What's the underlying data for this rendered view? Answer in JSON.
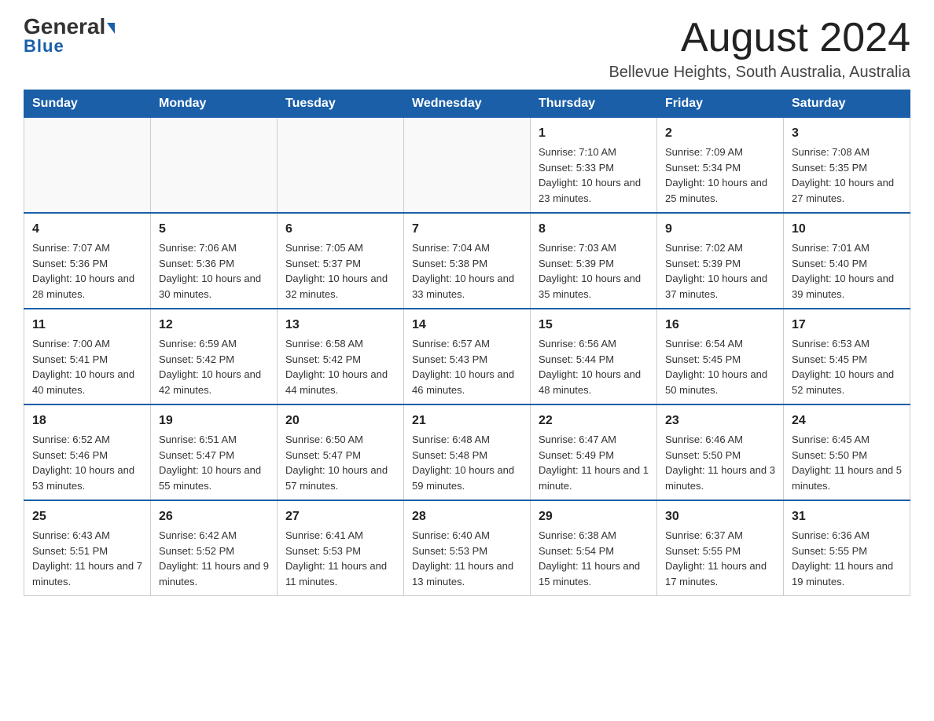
{
  "header": {
    "logo_general": "General",
    "logo_blue": "Blue",
    "month_title": "August 2024",
    "location": "Bellevue Heights, South Australia, Australia"
  },
  "calendar": {
    "days_of_week": [
      "Sunday",
      "Monday",
      "Tuesday",
      "Wednesday",
      "Thursday",
      "Friday",
      "Saturday"
    ],
    "weeks": [
      [
        {
          "day": "",
          "info": ""
        },
        {
          "day": "",
          "info": ""
        },
        {
          "day": "",
          "info": ""
        },
        {
          "day": "",
          "info": ""
        },
        {
          "day": "1",
          "info": "Sunrise: 7:10 AM\nSunset: 5:33 PM\nDaylight: 10 hours and 23 minutes."
        },
        {
          "day": "2",
          "info": "Sunrise: 7:09 AM\nSunset: 5:34 PM\nDaylight: 10 hours and 25 minutes."
        },
        {
          "day": "3",
          "info": "Sunrise: 7:08 AM\nSunset: 5:35 PM\nDaylight: 10 hours and 27 minutes."
        }
      ],
      [
        {
          "day": "4",
          "info": "Sunrise: 7:07 AM\nSunset: 5:36 PM\nDaylight: 10 hours and 28 minutes."
        },
        {
          "day": "5",
          "info": "Sunrise: 7:06 AM\nSunset: 5:36 PM\nDaylight: 10 hours and 30 minutes."
        },
        {
          "day": "6",
          "info": "Sunrise: 7:05 AM\nSunset: 5:37 PM\nDaylight: 10 hours and 32 minutes."
        },
        {
          "day": "7",
          "info": "Sunrise: 7:04 AM\nSunset: 5:38 PM\nDaylight: 10 hours and 33 minutes."
        },
        {
          "day": "8",
          "info": "Sunrise: 7:03 AM\nSunset: 5:39 PM\nDaylight: 10 hours and 35 minutes."
        },
        {
          "day": "9",
          "info": "Sunrise: 7:02 AM\nSunset: 5:39 PM\nDaylight: 10 hours and 37 minutes."
        },
        {
          "day": "10",
          "info": "Sunrise: 7:01 AM\nSunset: 5:40 PM\nDaylight: 10 hours and 39 minutes."
        }
      ],
      [
        {
          "day": "11",
          "info": "Sunrise: 7:00 AM\nSunset: 5:41 PM\nDaylight: 10 hours and 40 minutes."
        },
        {
          "day": "12",
          "info": "Sunrise: 6:59 AM\nSunset: 5:42 PM\nDaylight: 10 hours and 42 minutes."
        },
        {
          "day": "13",
          "info": "Sunrise: 6:58 AM\nSunset: 5:42 PM\nDaylight: 10 hours and 44 minutes."
        },
        {
          "day": "14",
          "info": "Sunrise: 6:57 AM\nSunset: 5:43 PM\nDaylight: 10 hours and 46 minutes."
        },
        {
          "day": "15",
          "info": "Sunrise: 6:56 AM\nSunset: 5:44 PM\nDaylight: 10 hours and 48 minutes."
        },
        {
          "day": "16",
          "info": "Sunrise: 6:54 AM\nSunset: 5:45 PM\nDaylight: 10 hours and 50 minutes."
        },
        {
          "day": "17",
          "info": "Sunrise: 6:53 AM\nSunset: 5:45 PM\nDaylight: 10 hours and 52 minutes."
        }
      ],
      [
        {
          "day": "18",
          "info": "Sunrise: 6:52 AM\nSunset: 5:46 PM\nDaylight: 10 hours and 53 minutes."
        },
        {
          "day": "19",
          "info": "Sunrise: 6:51 AM\nSunset: 5:47 PM\nDaylight: 10 hours and 55 minutes."
        },
        {
          "day": "20",
          "info": "Sunrise: 6:50 AM\nSunset: 5:47 PM\nDaylight: 10 hours and 57 minutes."
        },
        {
          "day": "21",
          "info": "Sunrise: 6:48 AM\nSunset: 5:48 PM\nDaylight: 10 hours and 59 minutes."
        },
        {
          "day": "22",
          "info": "Sunrise: 6:47 AM\nSunset: 5:49 PM\nDaylight: 11 hours and 1 minute."
        },
        {
          "day": "23",
          "info": "Sunrise: 6:46 AM\nSunset: 5:50 PM\nDaylight: 11 hours and 3 minutes."
        },
        {
          "day": "24",
          "info": "Sunrise: 6:45 AM\nSunset: 5:50 PM\nDaylight: 11 hours and 5 minutes."
        }
      ],
      [
        {
          "day": "25",
          "info": "Sunrise: 6:43 AM\nSunset: 5:51 PM\nDaylight: 11 hours and 7 minutes."
        },
        {
          "day": "26",
          "info": "Sunrise: 6:42 AM\nSunset: 5:52 PM\nDaylight: 11 hours and 9 minutes."
        },
        {
          "day": "27",
          "info": "Sunrise: 6:41 AM\nSunset: 5:53 PM\nDaylight: 11 hours and 11 minutes."
        },
        {
          "day": "28",
          "info": "Sunrise: 6:40 AM\nSunset: 5:53 PM\nDaylight: 11 hours and 13 minutes."
        },
        {
          "day": "29",
          "info": "Sunrise: 6:38 AM\nSunset: 5:54 PM\nDaylight: 11 hours and 15 minutes."
        },
        {
          "day": "30",
          "info": "Sunrise: 6:37 AM\nSunset: 5:55 PM\nDaylight: 11 hours and 17 minutes."
        },
        {
          "day": "31",
          "info": "Sunrise: 6:36 AM\nSunset: 5:55 PM\nDaylight: 11 hours and 19 minutes."
        }
      ]
    ]
  }
}
